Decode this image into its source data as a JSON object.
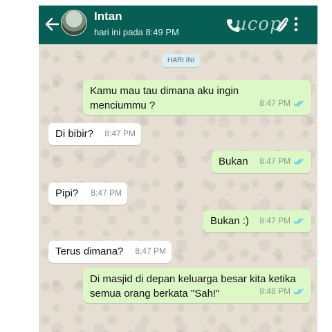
{
  "header": {
    "contact_name": "Intan",
    "last_seen": "hari ini pada 8:49 PM",
    "watermark": "ucop"
  },
  "chat": {
    "date_chip": "HARI INI",
    "messages": [
      {
        "direction": "out",
        "text": "Kamu mau tau dimana aku ingin\nmenciummu ?",
        "time": "8:47 PM",
        "status": "read"
      },
      {
        "direction": "in",
        "text": "Di bibir?",
        "time": "8:47 PM"
      },
      {
        "direction": "out",
        "text": "Bukan",
        "time": "8:47 PM",
        "status": "read"
      },
      {
        "direction": "in",
        "text": "Pipi?",
        "time": "8:47 PM"
      },
      {
        "direction": "out",
        "text": "Bukan :)",
        "time": "8:47 PM",
        "status": "read"
      },
      {
        "direction": "in",
        "text": "Terus dimana?",
        "time": "8:47 PM"
      },
      {
        "direction": "out",
        "text": "Di masjid di depan keluarga besar kita ketika\nsemua orang berkata \"Sah!\"",
        "time": "8:48 PM",
        "status": "read"
      }
    ]
  },
  "colors": {
    "header": "#075e54",
    "outgoing_bubble": "#dcf8c6",
    "incoming_bubble": "#ffffff",
    "read_ticks": "#4fc3f7"
  },
  "icons": [
    "back-arrow-icon",
    "phone-icon",
    "paperclip-icon",
    "more-vertical-icon",
    "read-ticks-icon"
  ]
}
